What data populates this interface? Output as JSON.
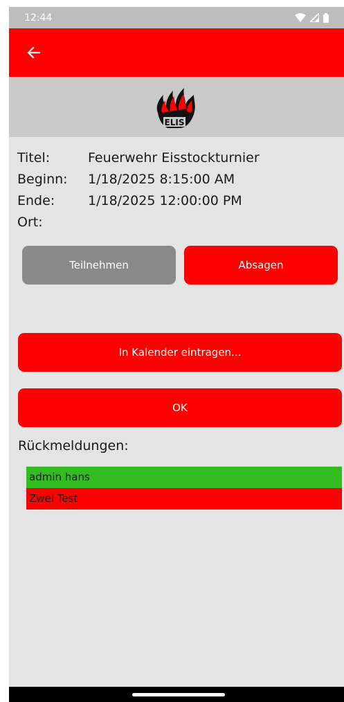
{
  "status_bar": {
    "time": "12:44"
  },
  "logo": {
    "text": "ELIS"
  },
  "event": {
    "rows": [
      {
        "key": "Titel:",
        "value": "Feuerwehr Eisstockturnier"
      },
      {
        "key": "Beginn:",
        "value": "1/18/2025 8:15:00 AM"
      },
      {
        "key": "Ende:",
        "value": "1/18/2025 12:00:00 PM"
      },
      {
        "key": "Ort:",
        "value": ""
      }
    ]
  },
  "buttons": {
    "participate": "Teilnehmen",
    "decline": "Absagen",
    "calendar": "In Kalender eintragen...",
    "ok": "OK"
  },
  "responses": {
    "title": "Rückmeldungen:",
    "items": [
      {
        "name": "admin hans",
        "color": "#33bb22"
      },
      {
        "name": "Zwei Test",
        "color": "#ff0000"
      }
    ]
  },
  "colors": {
    "accent": "#ff0000",
    "grey_button": "#8a8a8a",
    "accepted": "#33bb22"
  }
}
